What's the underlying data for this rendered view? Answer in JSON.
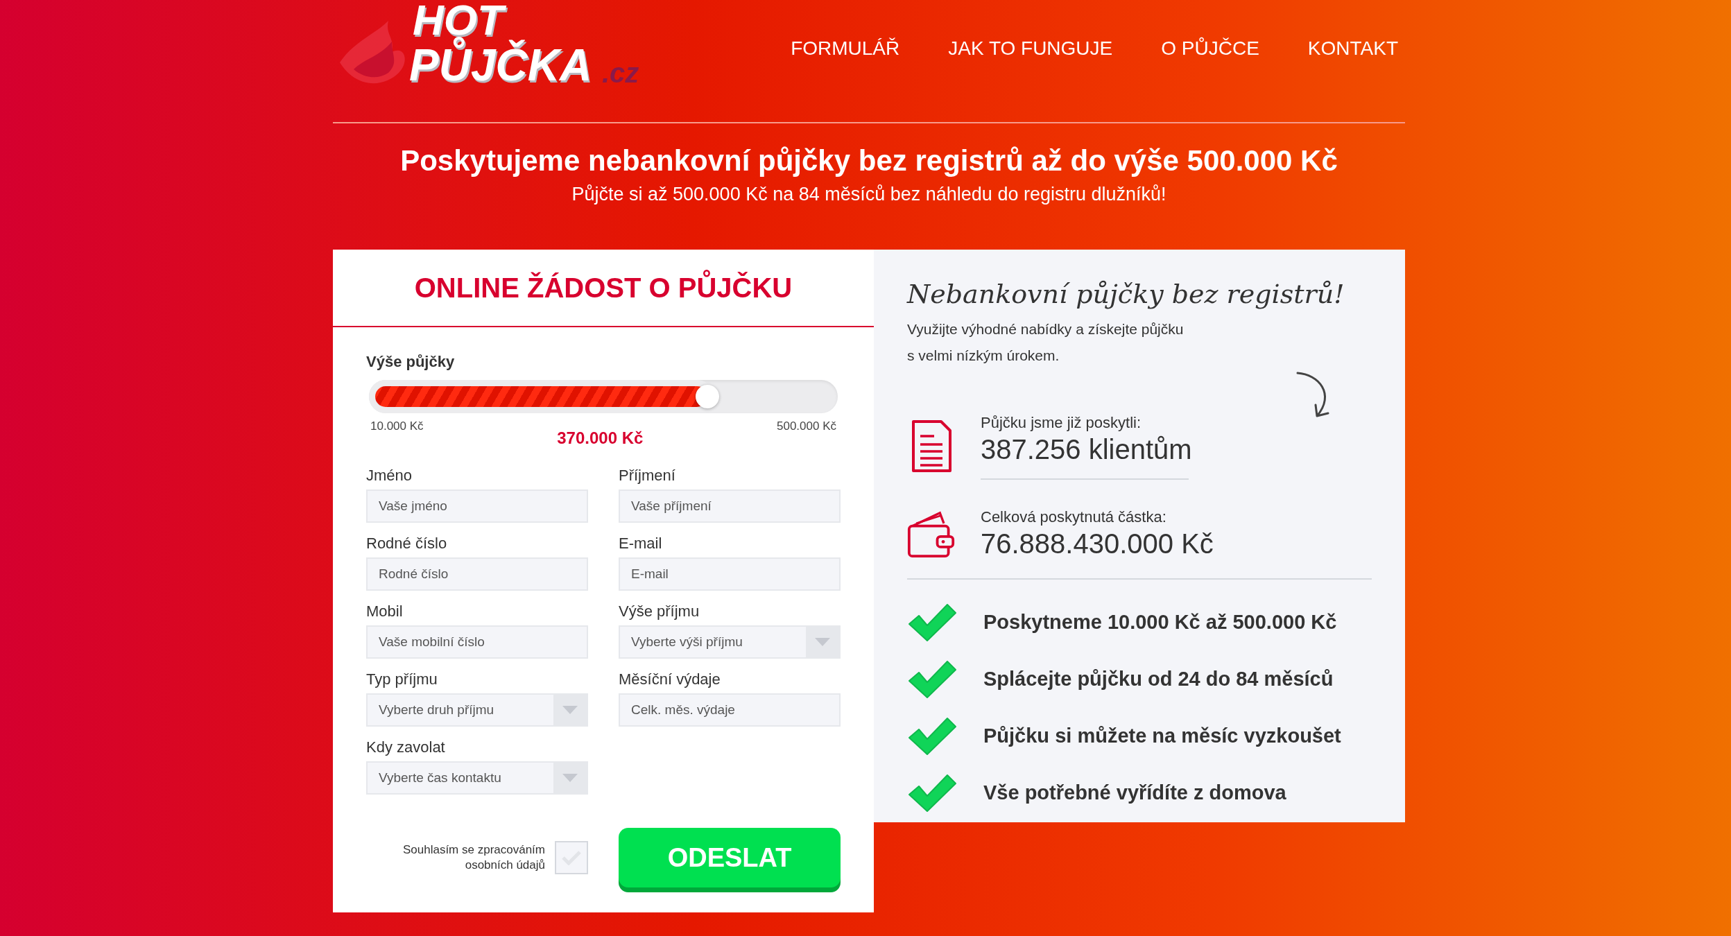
{
  "logo": {
    "line_1": "HOT",
    "line_2": "PŮJČKA",
    "suffix": ".cz"
  },
  "nav": [
    {
      "label": "FORMULÁŘ"
    },
    {
      "label": "JAK TO FUNGUJE"
    },
    {
      "label": "O PŮJČCE"
    },
    {
      "label": "KONTAKT"
    }
  ],
  "hero": {
    "headline": "Poskytujeme nebankovní půjčky bez registrů až do výše 500.000 Kč",
    "subline": "Půjčte si až 500.000 Kč na 84 měsíců bez náhledu do registru dlužníků!"
  },
  "form": {
    "title": "ONLINE ŽÁDOST O PŮJČKU",
    "slider": {
      "label": "Výše půjčky",
      "level": 0.735,
      "min": "10.000 Kč",
      "max": "500.000 Kč",
      "value": "370.000 Kč"
    },
    "fields": [
      {
        "label": "Jméno",
        "placeholder": "Vaše jméno",
        "kind": "text"
      },
      {
        "label": "Příjmení",
        "placeholder": "Vaše příjmení",
        "kind": "text"
      },
      {
        "label": "Rodné číslo",
        "placeholder": "Rodné číslo",
        "kind": "text"
      },
      {
        "label": "E-mail",
        "placeholder": "E-mail",
        "kind": "text"
      },
      {
        "label": "Mobil",
        "placeholder": "Vaše mobilní číslo",
        "kind": "text"
      },
      {
        "label": "Výše příjmu",
        "placeholder": "Vyberte výši příjmu",
        "kind": "select"
      },
      {
        "label": "Typ příjmu",
        "placeholder": "Vyberte druh příjmu",
        "kind": "select"
      },
      {
        "label": "Měsíční výdaje",
        "placeholder": "Celk. měs. výdaje",
        "kind": "text"
      },
      {
        "label": "Kdy zavolat",
        "placeholder": "Vyberte čas kontaktu",
        "kind": "select"
      }
    ],
    "consent": {
      "line_1": "Souhlasím se zpracováním",
      "line_2": "osobních údajů",
      "checked": false
    },
    "submit": "ODESLAT"
  },
  "info": {
    "title": "Nebankovní půjčky bez registrů!",
    "intro_1": "Využijte výhodné nabídky a získejte půjčku",
    "intro_2": "s velmi nízkým úrokem.",
    "stats": [
      {
        "kind": "document",
        "label": "Půjčku jsme již poskytli:",
        "value": "387.256 klientům"
      },
      {
        "kind": "wallet",
        "label": "Celková poskytnutá částka:",
        "value": "76.888.430.000 Kč"
      }
    ],
    "benefits": [
      "Poskytneme 10.000 Kč až 500.000 Kč",
      "Splácejte půjčku od 24 do 84 měsíců",
      "Půjčku si můžete na měsíc vyzkoušet",
      "Vše potřebné vyřídíte z domova"
    ]
  }
}
